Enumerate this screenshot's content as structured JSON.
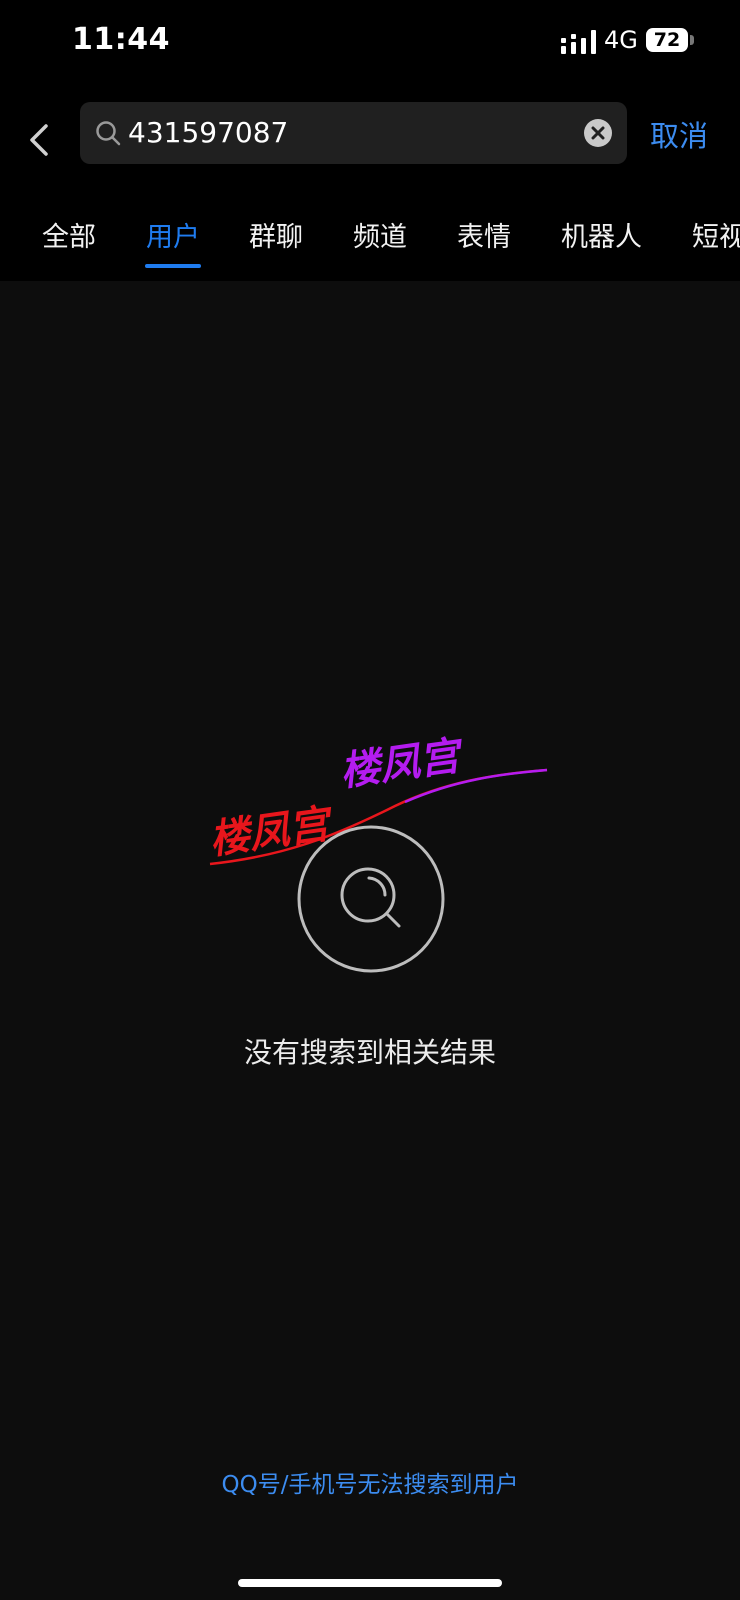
{
  "status_bar": {
    "time": "11:44",
    "network": "4G",
    "battery": "72"
  },
  "search": {
    "query": "431597087",
    "cancel_label": "取消"
  },
  "tabs": [
    {
      "label": "全部",
      "active": false
    },
    {
      "label": "用户",
      "active": true
    },
    {
      "label": "群聊",
      "active": false
    },
    {
      "label": "频道",
      "active": false
    },
    {
      "label": "表情",
      "active": false
    },
    {
      "label": "机器人",
      "active": false
    },
    {
      "label": "短视",
      "active": false
    }
  ],
  "empty_state": {
    "message": "没有搜索到相关结果",
    "hint_link": "QQ号/手机号无法搜索到用户"
  },
  "watermark": {
    "text_left": "楼凤宫",
    "text_right": "楼凤宫"
  },
  "colors": {
    "accent": "#1f7cf0",
    "link": "#3c8cf0",
    "background": "#0d0d0d",
    "watermark_red": "#e8161c",
    "watermark_purple": "#b41cf0"
  },
  "icons": [
    "back-arrow-icon",
    "search-icon",
    "clear-icon",
    "signal-icon",
    "battery-icon",
    "empty-search-icon"
  ]
}
